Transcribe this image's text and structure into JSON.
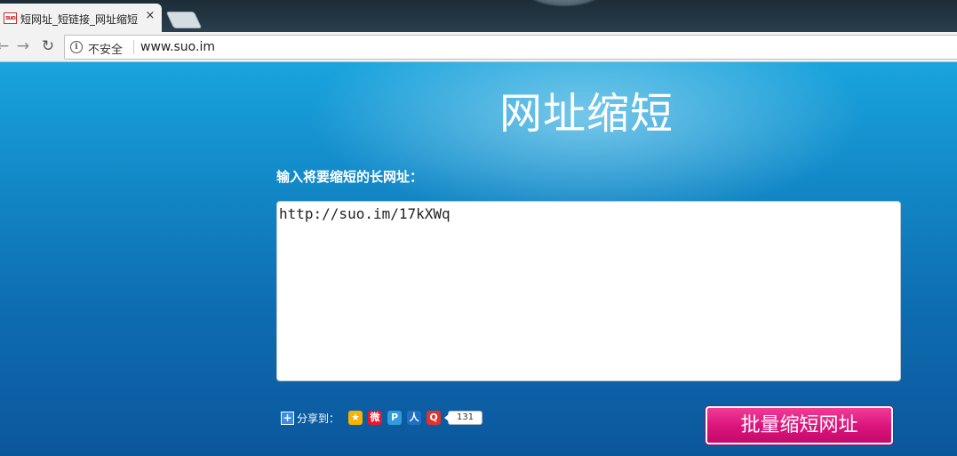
{
  "browser": {
    "tab": {
      "favicon_text": "suo",
      "title": "短网址_短链接_网址缩短",
      "close_glyph": "×"
    },
    "nav": {
      "back_glyph": "←",
      "forward_glyph": "→",
      "reload_glyph": "↻"
    },
    "address": {
      "info_glyph": "i",
      "security_label": "不安全",
      "url": "www.suo.im"
    }
  },
  "page": {
    "heading": "网址缩短",
    "prompt": "输入将要缩短的长网址：",
    "textarea_value": "http://suo.im/17kXWq",
    "share": {
      "plus_glyph": "+",
      "label": "分享到：",
      "services": [
        {
          "name": "qzone-icon",
          "glyph": "★",
          "color": "#f5b400"
        },
        {
          "name": "weibo-icon",
          "glyph": "微",
          "color": "#e6162d"
        },
        {
          "name": "tencent-weibo-icon",
          "glyph": "P",
          "color": "#2f9ddb"
        },
        {
          "name": "renren-icon",
          "glyph": "人",
          "color": "#1f6fc4"
        },
        {
          "name": "more-share-icon",
          "glyph": "Q",
          "color": "#e0322e"
        }
      ],
      "count": "131"
    },
    "submit_label": "批量缩短网址"
  },
  "colors": {
    "page_top": "#1aa4dd",
    "page_bottom": "#0c579c",
    "button": "#d9137a"
  }
}
